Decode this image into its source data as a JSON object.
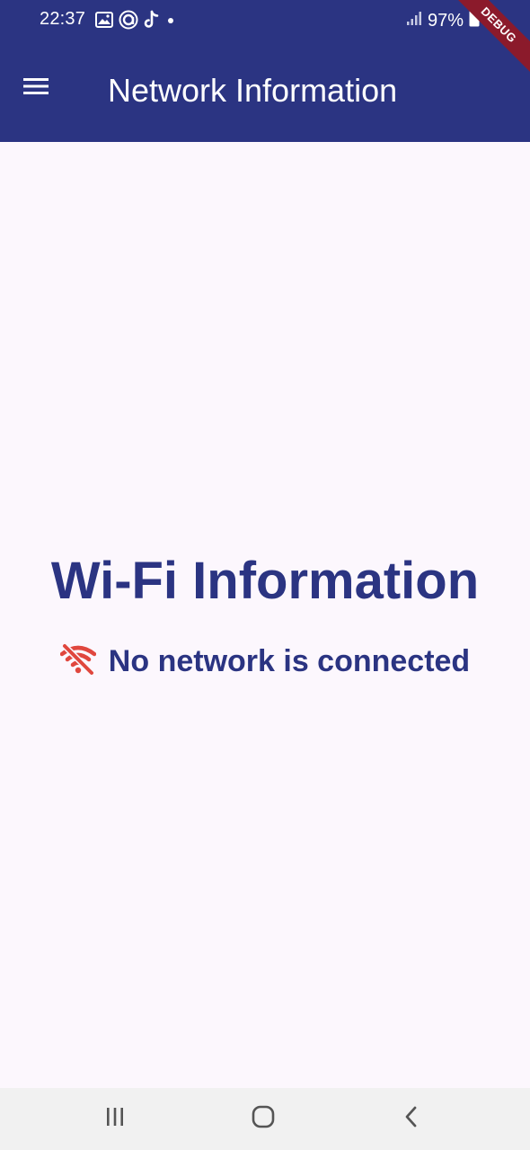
{
  "status_bar": {
    "time": "22:37",
    "battery": "97%",
    "icons": [
      "gallery-icon",
      "app-icon",
      "tiktok-icon",
      "dot-icon",
      "signal-icon",
      "battery-icon"
    ]
  },
  "app_bar": {
    "title": "Network Information",
    "menu_icon": "hamburger-menu-icon",
    "debug_banner": "DEBUG"
  },
  "main": {
    "heading": "Wi-Fi Information",
    "status_text": "No network is connected",
    "status_icon": "wifi-off-icon"
  },
  "nav_bar": {
    "items": [
      "recent-apps-icon",
      "home-icon",
      "back-icon"
    ]
  },
  "colors": {
    "primary": "#2b3482",
    "background": "#fcf7fd",
    "wifi_off": "#e0473e",
    "nav_bar": "#f1f1f1",
    "debug_banner": "#8b1a2b"
  }
}
